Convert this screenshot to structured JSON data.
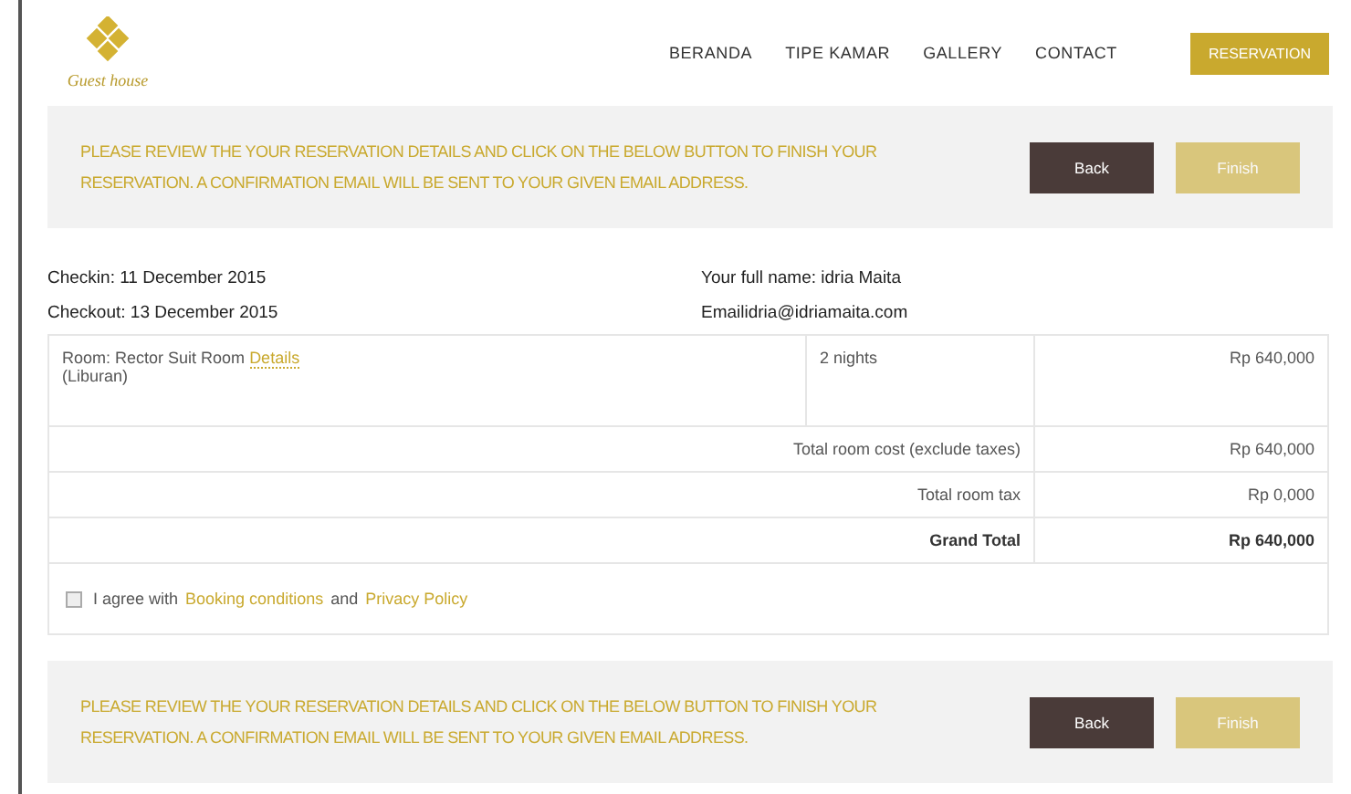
{
  "header": {
    "logo_text": "Guest house",
    "nav": [
      {
        "label": "BERANDA"
      },
      {
        "label": "TIPE KAMAR"
      },
      {
        "label": "GALLERY"
      },
      {
        "label": "CONTACT"
      }
    ],
    "cta": "RESERVATION"
  },
  "notices": [
    {
      "message": "PLEASE REVIEW THE YOUR RESERVATION DETAILS AND CLICK ON THE BELOW BUTTON TO FINISH YOUR RESERVATION. A CONFIRMATION EMAIL WILL BE SENT TO YOUR GIVEN EMAIL ADDRESS.",
      "buttons": [
        {
          "label": "Back",
          "disabled": false
        },
        {
          "label": "Finish",
          "disabled": true
        }
      ]
    }
  ],
  "info": {
    "checkin": "Checkin: 11 December 2015",
    "checkout": "Checkout: 13 December 2015",
    "name": "Your full name: idria Maita",
    "email": "Emailidria@idriamaita.com"
  },
  "room": {
    "label": "Room: Rector Suit Room",
    "link": "Details",
    "type": "(Liburan)",
    "nights": "2 nights",
    "price": "Rp 640,000"
  },
  "totals": [
    {
      "label": "Total room cost (exclude taxes)",
      "value": "Rp 640,000",
      "bold": false
    },
    {
      "label": "Total room tax",
      "value": "Rp 0,000",
      "bold": false
    },
    {
      "label": "Grand Total",
      "value": "Rp 640,000",
      "bold": true
    }
  ],
  "agreement": {
    "checked": false,
    "parts": [
      {
        "kind": "text",
        "text": "I agree with"
      },
      {
        "kind": "link",
        "text": "Booking conditions"
      },
      {
        "kind": "text",
        "text": "and"
      },
      {
        "kind": "link",
        "text": "Privacy Policy"
      }
    ]
  },
  "notices_bottom": [
    {
      "message": "PLEASE REVIEW THE YOUR RESERVATION DETAILS AND CLICK ON THE BELOW BUTTON TO FINISH YOUR RESERVATION. A CONFIRMATION EMAIL WILL BE SENT TO YOUR GIVEN EMAIL ADDRESS.",
      "buttons": [
        {
          "label": "Back",
          "disabled": false
        },
        {
          "label": "Finish",
          "disabled": true
        }
      ]
    }
  ]
}
